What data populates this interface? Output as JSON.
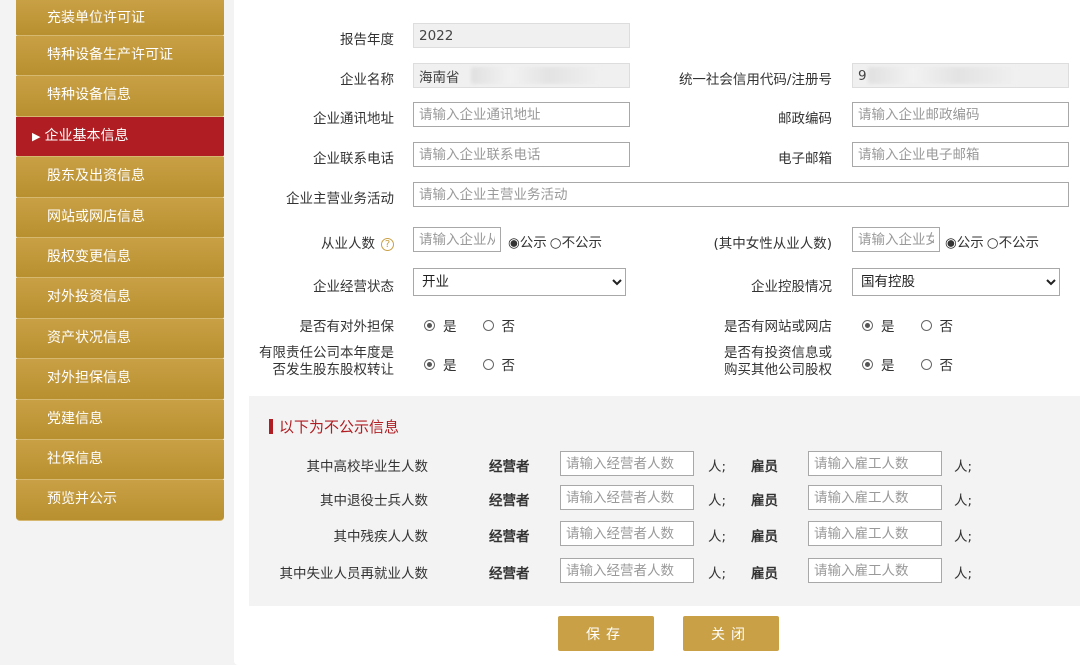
{
  "sidebar": {
    "items": [
      {
        "label": "充装单位许可证"
      },
      {
        "label": "特种设备生产许可证"
      },
      {
        "label": "特种设备信息"
      },
      {
        "label": "企业基本信息",
        "active": true
      },
      {
        "label": "股东及出资信息"
      },
      {
        "label": "网站或网店信息"
      },
      {
        "label": "股权变更信息"
      },
      {
        "label": "对外投资信息"
      },
      {
        "label": "资产状况信息"
      },
      {
        "label": "对外担保信息"
      },
      {
        "label": "党建信息"
      },
      {
        "label": "社保信息"
      },
      {
        "label": "预览并公示"
      }
    ],
    "active_arrow": "▶"
  },
  "form": {
    "report_year": {
      "label": "报告年度",
      "value": "2022"
    },
    "company_name": {
      "label": "企业名称",
      "value": "海南省"
    },
    "credit_code": {
      "label": "统一社会信用代码/注册号",
      "value": "9"
    },
    "address": {
      "label": "企业通讯地址",
      "placeholder": "请输入企业通讯地址"
    },
    "postcode": {
      "label": "邮政编码",
      "placeholder": "请输入企业邮政编码"
    },
    "phone": {
      "label": "企业联系电话",
      "placeholder": "请输入企业联系电话"
    },
    "email": {
      "label": "电子邮箱",
      "placeholder": "请输入企业电子邮箱"
    },
    "main_business": {
      "label": "企业主营业务活动",
      "placeholder": "请输入企业主营业务活动"
    },
    "employees": {
      "label": "从业人数",
      "placeholder": "请输入企业从业人数",
      "opt_public": "公示",
      "opt_private": "不公示",
      "selected": "公示"
    },
    "female_employees": {
      "label": "(其中女性从业人数)",
      "placeholder": "请输入企业女性从业人数",
      "opt_public": "公示",
      "opt_private": "不公示",
      "selected": "公示"
    },
    "business_status": {
      "label": "企业经营状态",
      "value": "开业"
    },
    "holding_status": {
      "label": "企业控股情况",
      "value": "国有控股"
    },
    "external_guarantee": {
      "label": "是否有对外担保",
      "yes": "是",
      "no": "否",
      "selected": "是"
    },
    "website": {
      "label": "是否有网站或网店",
      "yes": "是",
      "no": "否",
      "selected": "是"
    },
    "equity_transfer": {
      "label_line1": "有限责任公司本年度是",
      "label_line2": "否发生股东股权转让",
      "yes": "是",
      "no": "否",
      "selected": "是"
    },
    "investment": {
      "label_line1": "是否有投资信息或",
      "label_line2": "购买其他公司股权",
      "yes": "是",
      "no": "否",
      "selected": "是"
    }
  },
  "non_public": {
    "title": "以下为不公示信息",
    "operator_label": "经营者",
    "employee_label": "雇员",
    "unit": "人;",
    "operator_placeholder": "请输入经营者人数",
    "employee_placeholder": "请输入雇工人数",
    "rows": [
      {
        "label": "其中高校毕业生人数"
      },
      {
        "label": "其中退役士兵人数"
      },
      {
        "label": "其中残疾人人数"
      },
      {
        "label": "其中失业人员再就业人数"
      }
    ]
  },
  "buttons": {
    "save": "保存",
    "close": "关闭"
  },
  "colors": {
    "gold": "#c9a045",
    "active_red": "#b01e23"
  }
}
